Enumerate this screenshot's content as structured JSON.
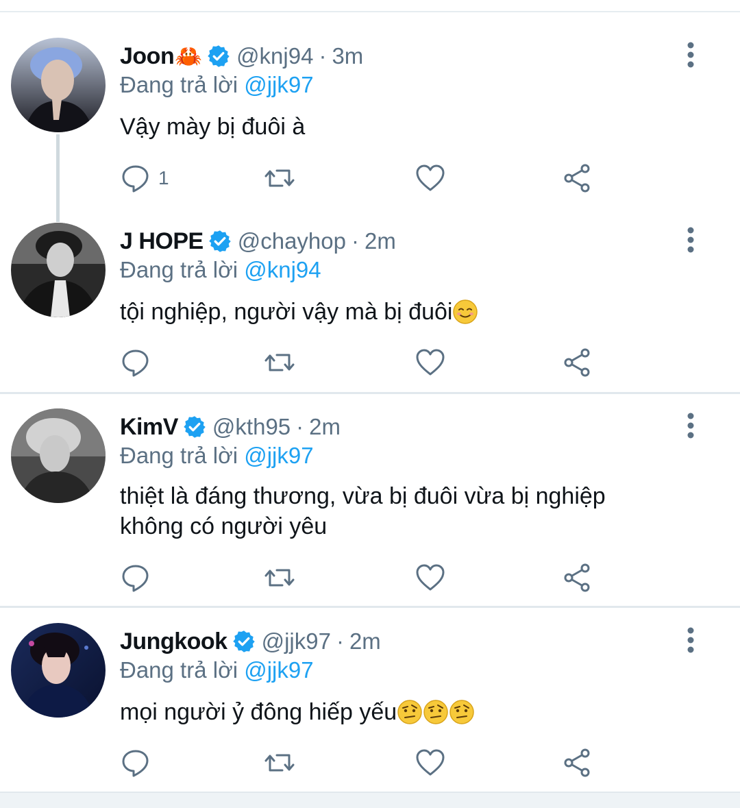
{
  "tweets": [
    {
      "name": "Joon",
      "name_emoji": "🦀",
      "handle": "@knj94",
      "time": "3m",
      "reply_label": "Đang trả lời",
      "reply_to": "@jjk97",
      "text": "Vậy mày bị đuôi à",
      "emojis": [],
      "reply_count": "1"
    },
    {
      "name": "J HOPE",
      "handle": "@chayhop",
      "time": "2m",
      "reply_label": "Đang trả lời",
      "reply_to": "@knj94",
      "text": "tội nghiệp, người vậy mà bị đuôi",
      "emojis": [
        "smiling-face-icon"
      ]
    },
    {
      "name": "KimV",
      "handle": "@kth95",
      "time": "2m",
      "reply_label": "Đang trả lời",
      "reply_to": "@jjk97",
      "text_line1": "thiệt là đáng thương, vừa bị đuôi vừa bị nghiệp",
      "text_line2": "không có người yêu",
      "emojis": []
    },
    {
      "name": "Jungkook",
      "handle": "@jjk97",
      "time": "2m",
      "reply_label": "Đang trả lời",
      "reply_to": "@jjk97",
      "text": "mọi người ỷ đông hiếp yếu",
      "emojis": [
        "raised-eyebrow-icon",
        "raised-eyebrow-icon",
        "raised-eyebrow-icon"
      ]
    }
  ],
  "separator": "·",
  "colors": {
    "accent": "#1da1f2",
    "muted": "#5b7083",
    "text": "#0f1419",
    "divider": "#e1e8ed"
  }
}
